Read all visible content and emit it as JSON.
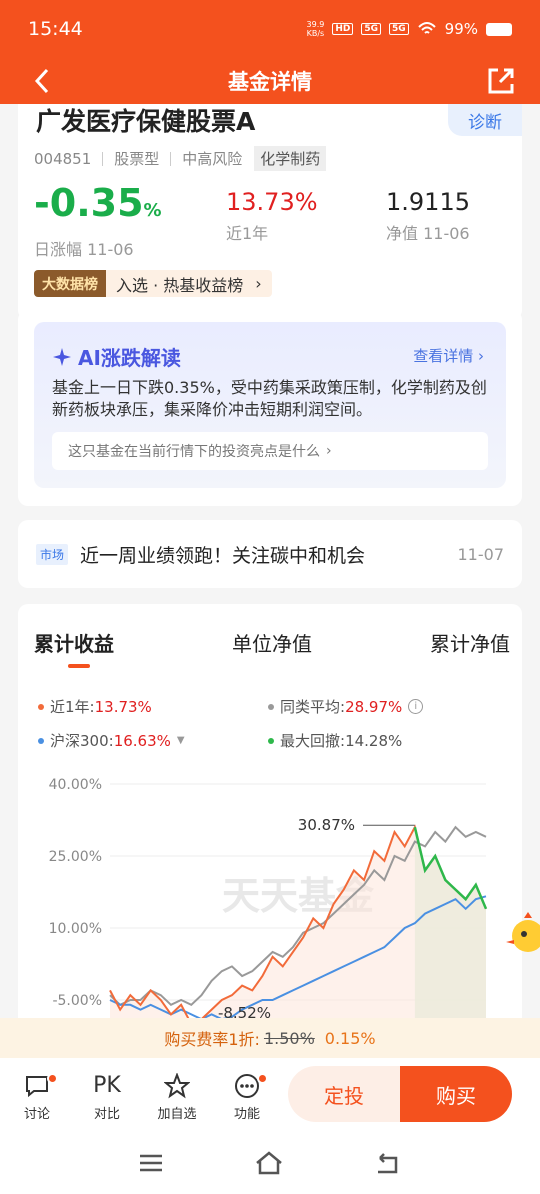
{
  "status": {
    "time": "15:44",
    "netspeed_value": "39.9",
    "netspeed_unit": "KB/s",
    "hd": "HD",
    "signal1": "5G",
    "signal2": "5G",
    "battery": "99%"
  },
  "nav": {
    "title": "基金详情"
  },
  "fund": {
    "name": "广发医疗保健股票A",
    "diagnose": "诊断",
    "code": "004851",
    "type": "股票型",
    "risk": "中高风险",
    "sector": "化学制药",
    "daily_change_value": "-0.35",
    "daily_change_unit": "%",
    "daily_change_label": "日涨幅 11-06",
    "year_return": "13.73%",
    "year_label": "近1年",
    "nav_value": "1.9115",
    "nav_label": "净值 11-06",
    "rank_badge": "大数据榜",
    "rank_text": "入选 · 热基收益榜"
  },
  "ai": {
    "title": "AI涨跌解读",
    "more": "查看详情",
    "text": "基金上一日下跌0.35%，受中药集采政策压制，化学制药及创新药板块承压，集采降价冲击短期利润空间。",
    "question": "这只基金在当前行情下的投资亮点是什么"
  },
  "news": {
    "tag": "市场",
    "title": "近一周业绩领跑！关注碳中和机会",
    "date": "11-07"
  },
  "chart_tabs": [
    "累计收益",
    "单位净值",
    "累计净值"
  ],
  "legend": {
    "fund_label": "近1年:",
    "fund_value": "13.73%",
    "peer_label": "同类平均:",
    "peer_value": "28.97%",
    "index_label": "沪深300:",
    "index_value": "16.63%",
    "drawdown_label": "最大回撤:",
    "drawdown_value": "14.28%"
  },
  "chart_data": {
    "type": "line",
    "yticks": [
      "40.00%",
      "25.00%",
      "10.00%",
      "-5.00%"
    ],
    "ylim": [
      -10,
      40
    ],
    "annotations": [
      "30.87%",
      "-8.52%"
    ],
    "watermark": "天天基金",
    "series": [
      {
        "name": "近1年",
        "color": "#f26b3a",
        "values": [
          -3,
          -7,
          -4,
          -6,
          -3,
          -5,
          -8,
          -6,
          -10,
          -9,
          -7,
          -5,
          -4,
          -2,
          -3,
          0,
          4,
          2,
          5,
          8,
          12,
          10,
          15,
          18,
          22,
          20,
          26,
          24,
          30,
          27,
          31,
          22,
          25,
          20,
          18,
          16,
          19,
          14
        ]
      },
      {
        "name": "同类平均",
        "color": "#999999",
        "values": [
          -4,
          -6,
          -5,
          -5,
          -3,
          -4,
          -6,
          -5,
          -6,
          -4,
          -1,
          1,
          2,
          0,
          1,
          3,
          5,
          4,
          6,
          9,
          10,
          11,
          13,
          15,
          17,
          19,
          22,
          20,
          25,
          24,
          28,
          27,
          30,
          28,
          31,
          29,
          30,
          29
        ]
      },
      {
        "name": "沪深300",
        "color": "#4a90e2",
        "values": [
          -5,
          -6,
          -6,
          -7,
          -6,
          -7,
          -8,
          -7,
          -8,
          -9,
          -8,
          -9,
          -8.5,
          -7,
          -6,
          -5,
          -5,
          -4,
          -3,
          -2,
          -1,
          0,
          1,
          2,
          3,
          4,
          5,
          6,
          8,
          10,
          11,
          13,
          14,
          15,
          16,
          14,
          16,
          16.6
        ]
      }
    ],
    "drawdown_color": "#2eb84b"
  },
  "promo": {
    "label": "购买费率1折:",
    "old": "1.50%",
    "new": "0.15%"
  },
  "toolbar": {
    "discuss": "讨论",
    "pk_icon": "PK",
    "pk": "对比",
    "watch": "加自选",
    "more": "功能",
    "dca": "定投",
    "buy": "购买"
  }
}
